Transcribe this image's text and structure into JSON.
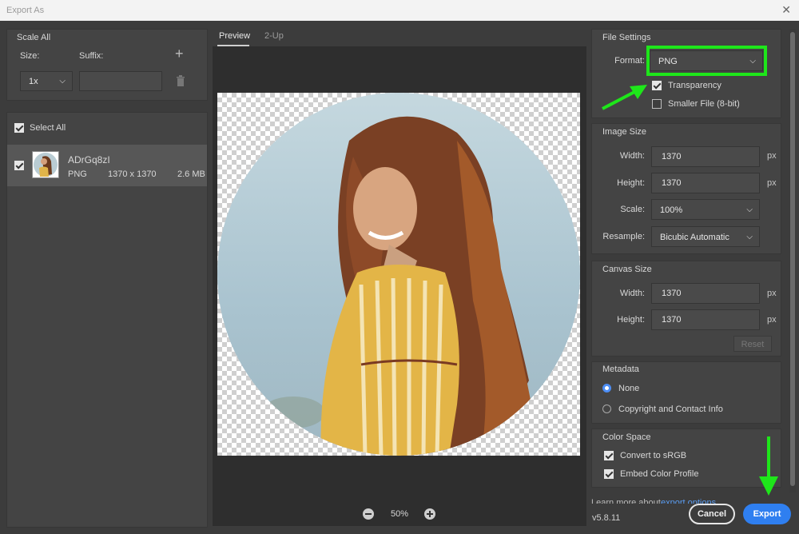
{
  "window": {
    "title": "Export As",
    "close_glyph": "✕"
  },
  "left": {
    "scale_all": "Scale All",
    "size_label": "Size:",
    "suffix_label": "Suffix:",
    "size_value": "1x",
    "suffix_value": "",
    "select_all": "Select All",
    "asset": {
      "name": "ADrGq8zI",
      "format": "PNG",
      "dimensions": "1370 x 1370",
      "filesize": "2.6 MB"
    }
  },
  "preview": {
    "tab_preview": "Preview",
    "tab_2up": "2-Up",
    "zoom": "50%"
  },
  "file_settings": {
    "section": "File Settings",
    "format_label": "Format:",
    "format_value": "PNG",
    "transparency": "Transparency",
    "transparency_checked": true,
    "smaller_file": "Smaller File (8-bit)",
    "smaller_file_checked": false
  },
  "image_size": {
    "section": "Image Size",
    "width_label": "Width:",
    "width_value": "1370",
    "height_label": "Height:",
    "height_value": "1370",
    "scale_label": "Scale:",
    "scale_value": "100%",
    "resample_label": "Resample:",
    "resample_value": "Bicubic Automatic",
    "unit": "px"
  },
  "canvas_size": {
    "section": "Canvas Size",
    "width_label": "Width:",
    "width_value": "1370",
    "height_label": "Height:",
    "height_value": "1370",
    "unit": "px",
    "reset": "Reset"
  },
  "metadata": {
    "section": "Metadata",
    "none": "None",
    "copyright": "Copyright and Contact Info",
    "selected": "None"
  },
  "color_space": {
    "section": "Color Space",
    "convert_srgb": "Convert to sRGB",
    "embed_profile": "Embed Color Profile"
  },
  "footer": {
    "learn_more": "Learn more about",
    "learn_link": "export options.",
    "version": "v5.8.11",
    "cancel": "Cancel",
    "export": "Export"
  },
  "colors": {
    "accent_blue": "#2f7ff0",
    "highlight_green": "#1ee61a"
  }
}
